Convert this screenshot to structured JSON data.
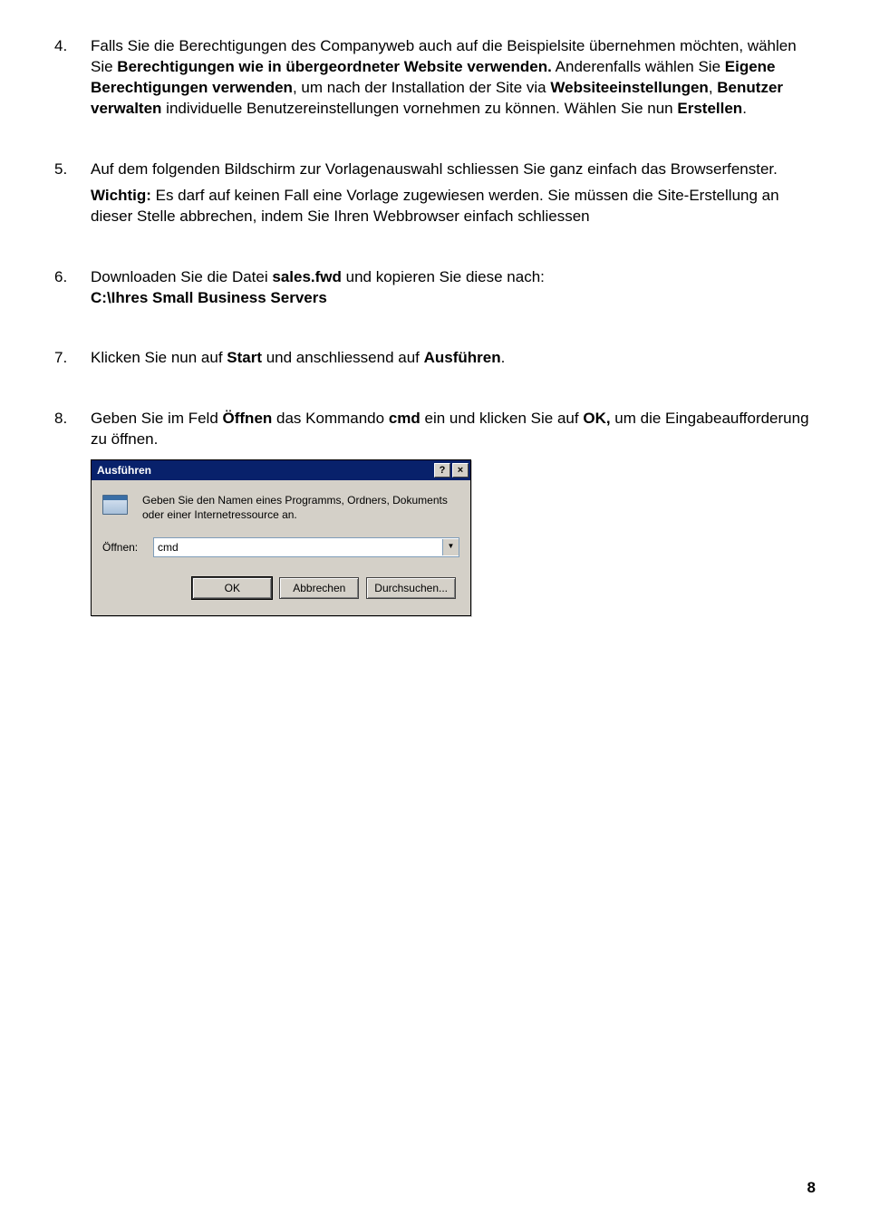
{
  "steps": {
    "s4": {
      "num": "4.",
      "p1a": "Falls Sie die Berechtigungen des Companyweb auch auf die Beispielsite übernehmen möchten, wählen Sie ",
      "p1b": "Berechtigungen wie in übergeordneter Website verwenden.",
      "p1c": " Anderenfalls wählen Sie ",
      "p1d": "Eigene Berechtigungen verwenden",
      "p1e": ", um nach der Installation der Site via ",
      "p1f": "Websiteeinstellungen",
      "p1g": ", ",
      "p1h": "Benutzer verwalten",
      "p1i": " individuelle Benutzereinstellungen vornehmen zu können. Wählen Sie nun ",
      "p1j": "Erstellen",
      "p1k": "."
    },
    "s5": {
      "num": "5.",
      "p1": "Auf dem folgenden Bildschirm zur Vorlagenauswahl schliessen Sie ganz einfach das Browserfenster.",
      "p2a": "Wichtig:",
      "p2b": " Es darf auf keinen Fall eine Vorlage zugewiesen werden. Sie müssen die Site-Erstellung an dieser Stelle abbrechen, indem Sie Ihren Webbrowser einfach schliessen"
    },
    "s6": {
      "num": "6.",
      "p1a": "Downloaden Sie die Datei ",
      "p1b": "sales.fwd",
      "p1c": " und kopieren Sie diese nach:",
      "p2": "C:\\Ihres Small Business Servers"
    },
    "s7": {
      "num": "7.",
      "p1a": "Klicken Sie nun auf ",
      "p1b": "Start",
      "p1c": " und anschliessend auf ",
      "p1d": "Ausführen",
      "p1e": "."
    },
    "s8": {
      "num": "8.",
      "p1a": "Geben Sie im Feld ",
      "p1b": "Öffnen",
      "p1c": " das Kommando ",
      "p1d": "cmd",
      "p1e": " ein und klicken Sie auf ",
      "p1f": "OK,",
      "p1g": " um die Eingabeaufforderung zu öffnen."
    }
  },
  "dialog": {
    "title": "Ausführen",
    "help": "?",
    "close": "×",
    "desc": "Geben Sie den Namen eines Programms, Ordners, Dokuments oder einer Internetressource an.",
    "open_label": "Öffnen:",
    "open_value": "cmd",
    "dd": "▼",
    "ok": "OK",
    "cancel": "Abbrechen",
    "browse": "Durchsuchen..."
  },
  "page_number": "8"
}
